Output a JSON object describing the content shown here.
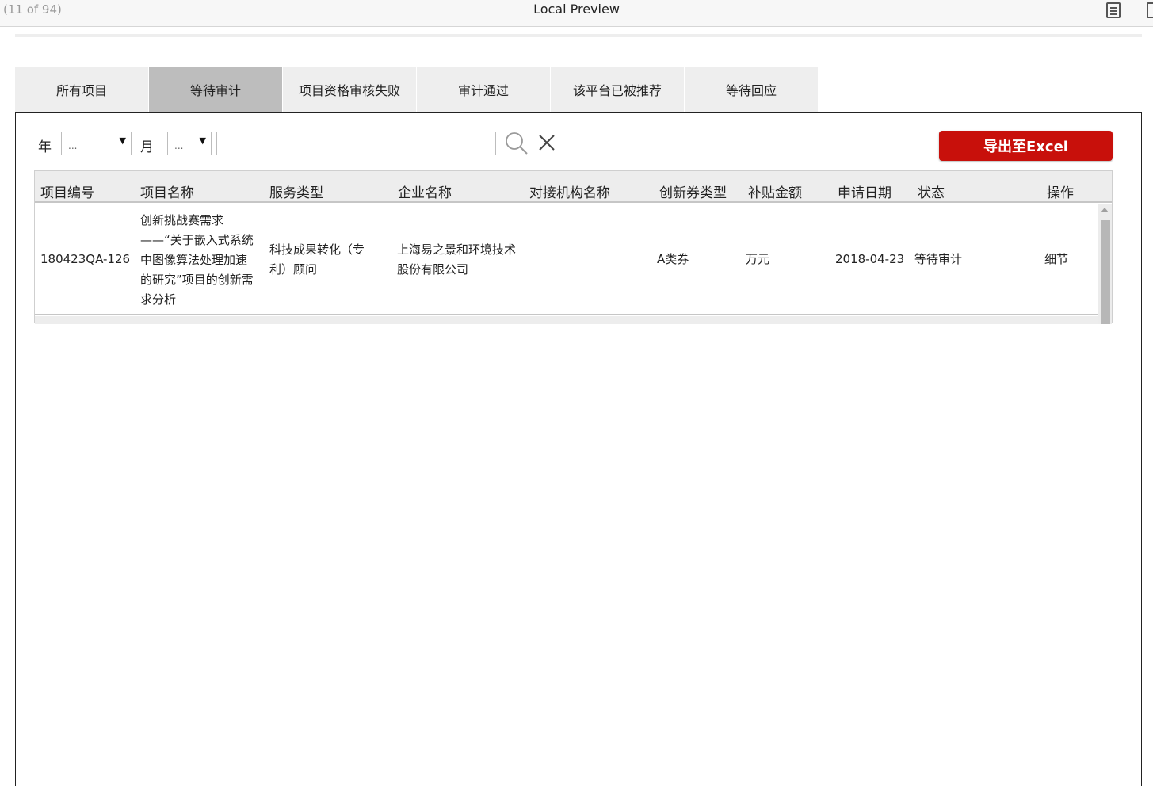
{
  "preview": {
    "pager": "(11 of 94)",
    "title": "Local Preview",
    "icons": [
      "list-view-icon",
      "fit-page-icon"
    ]
  },
  "tabs": [
    {
      "label": "所有项目",
      "active": false
    },
    {
      "label": "等待审计",
      "active": true
    },
    {
      "label": "项目资格审核失败",
      "active": false
    },
    {
      "label": "审计通过",
      "active": false
    },
    {
      "label": "该平台已被推荐",
      "active": false
    },
    {
      "label": "等待回应",
      "active": false
    }
  ],
  "filters": {
    "year_label": "年",
    "year_value": "...",
    "month_label": "月",
    "month_value": "...",
    "search_value": "",
    "export_label": "导出至Excel"
  },
  "table": {
    "columns": [
      "项目编号",
      "项目名称",
      "服务类型",
      "企业名称",
      "对接机构名称",
      "创新券类型",
      "补贴金额",
      "申请日期",
      "状态",
      "操作"
    ],
    "rows": [
      {
        "id": "180423QA-126",
        "name": "创新挑战赛需求——“关于嵌入式系统中图像算法处理加速的研究”项目的创新需求分析",
        "name_lines": [
          "创新挑战赛需求",
          "——“关于嵌入式系统",
          "中图像算法处理加速",
          "的研究”项目的创新需",
          "求分析"
        ],
        "service_type": "科技成果转化（专利）顾问",
        "service_type_lines": [
          "科技成果转化（专",
          "利）顾问"
        ],
        "company": "上海易之景和环境技术股份有限公司",
        "company_lines": [
          "上海易之景和环境技术",
          "股份有限公司"
        ],
        "agency": "",
        "voucher_type": "A类券",
        "subsidy": "万元",
        "date": "2018-04-23",
        "status": "等待审计",
        "action": "细节"
      }
    ]
  },
  "colors": {
    "accent": "#c8100b",
    "tab_bg": "#eeeeee",
    "tab_active_bg": "#bdbdbd",
    "header_bg": "#ededed"
  }
}
